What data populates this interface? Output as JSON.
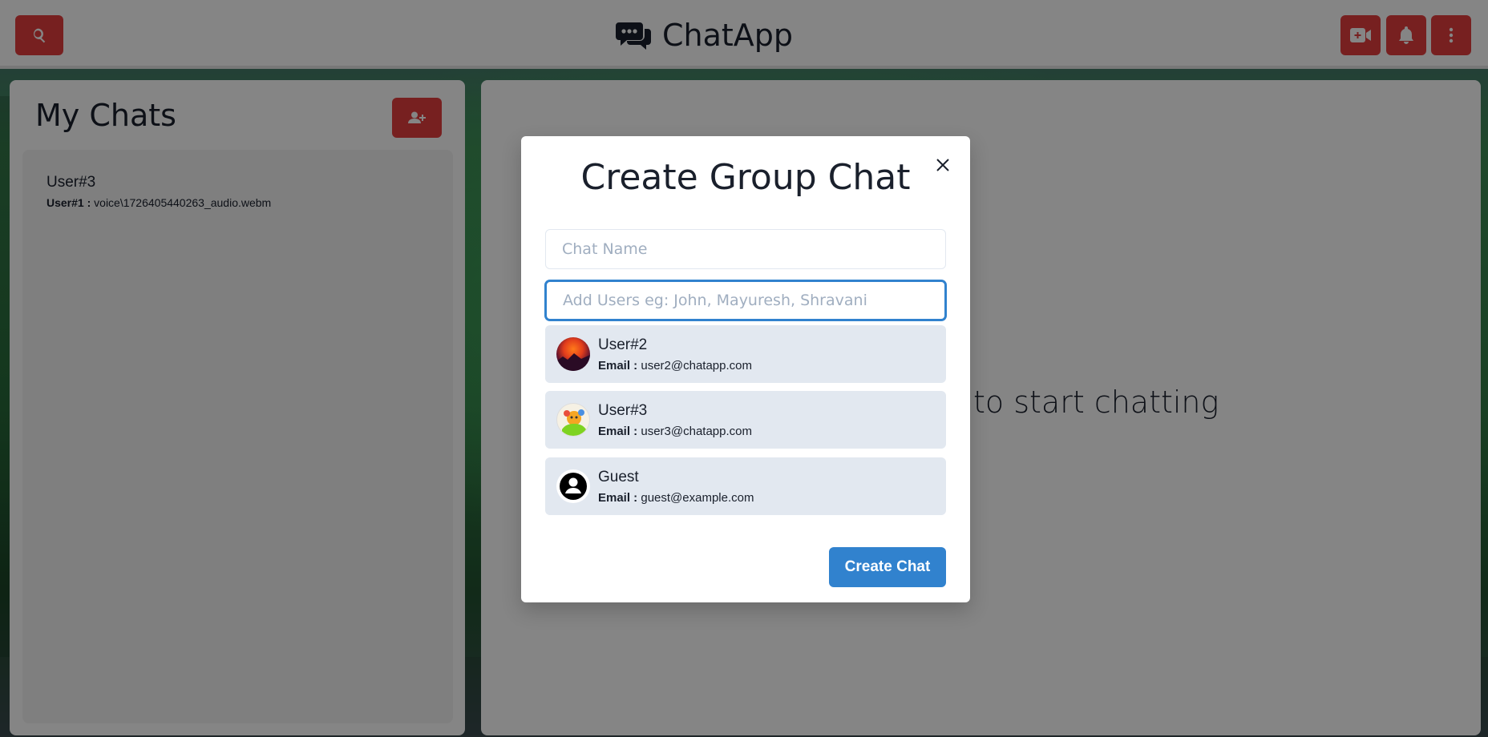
{
  "app": {
    "title": "ChatApp",
    "accent_color": "#e53e3e",
    "primary_color": "#3182ce"
  },
  "topbar": {
    "search_icon": "search-icon",
    "video_icon": "video-icon",
    "bell_icon": "bell-icon",
    "menu_icon": "more-vertical-icon"
  },
  "sidebar": {
    "title": "My Chats",
    "add_group_icon": "user-plus-icon",
    "chats": [
      {
        "name": "User#3",
        "last_sender": "User#1 :",
        "last_message": "voice\\1726405440263_audio.webm"
      }
    ]
  },
  "main": {
    "hint_visible": "to start chatting"
  },
  "modal": {
    "title": "Create Group Chat",
    "chat_name_placeholder": "Chat Name",
    "chat_name_value": "",
    "users_placeholder": "Add Users eg: John, Mayuresh, Shravani",
    "users_value": "",
    "results": [
      {
        "name": "User#2",
        "email_label": "Email :",
        "email": "user2@chatapp.com",
        "avatar": "sunset-avatar"
      },
      {
        "name": "User#3",
        "email_label": "Email :",
        "email": "user3@chatapp.com",
        "avatar": "cartoon-avatar"
      },
      {
        "name": "Guest",
        "email_label": "Email :",
        "email": "guest@example.com",
        "avatar": "default-user-avatar"
      }
    ],
    "create_label": "Create Chat"
  }
}
